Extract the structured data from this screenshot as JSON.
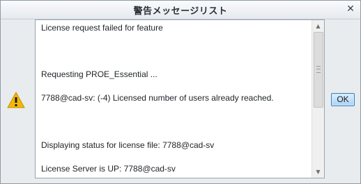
{
  "window": {
    "title": "警告メッセージリスト",
    "close_glyph": "✕"
  },
  "icons": {
    "warning": "warning-icon",
    "close": "close-icon"
  },
  "messages": {
    "lines": [
      "License request failed for feature",
      "Requesting PROE_Essential ...",
      "7788@cad-sv: (-4) Licensed number of users already reached.",
      "Displaying status for license file: 7788@cad-sv",
      "License Server is UP: 7788@cad-sv"
    ]
  },
  "scrollbar": {
    "up_glyph": "▲",
    "down_glyph": "▼"
  },
  "buttons": {
    "ok_label": "OK"
  },
  "colors": {
    "warning": "#f5b800",
    "ok_button": "#a9d3f5",
    "ok_border": "#3c7fb1"
  }
}
